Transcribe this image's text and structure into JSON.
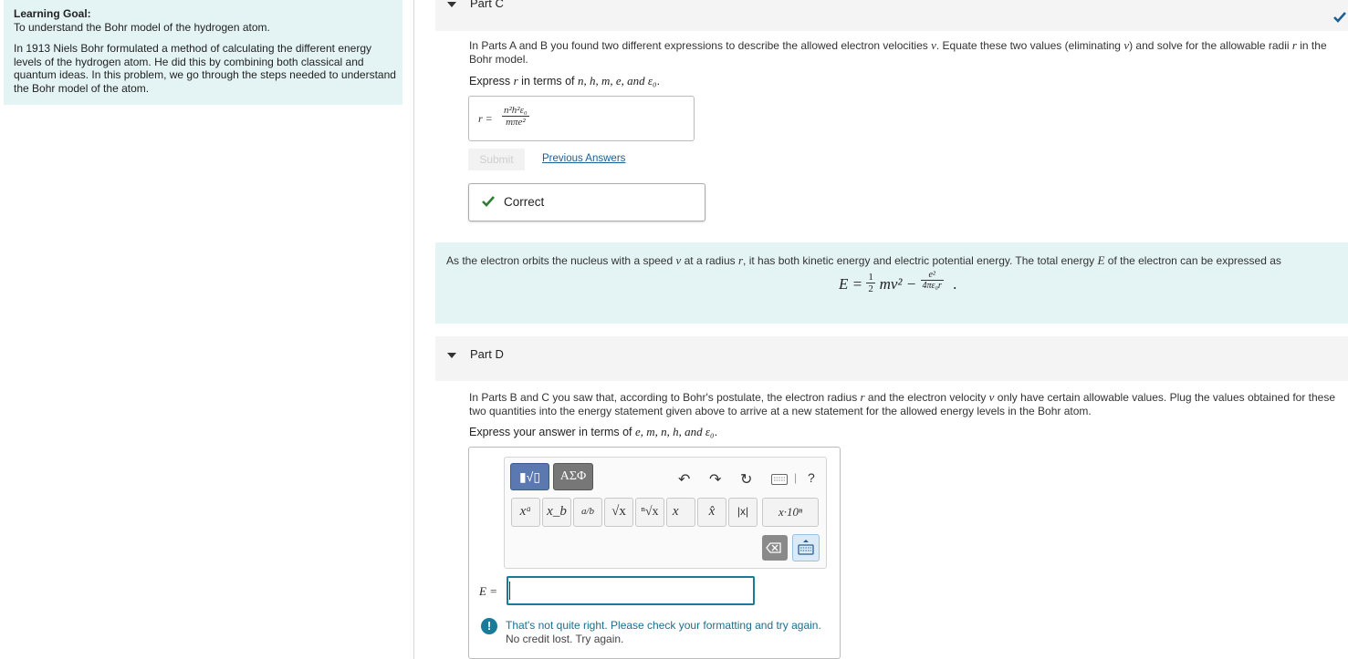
{
  "sidebar": {
    "goal_heading": "Learning Goal:",
    "goal_text": "To understand the Bohr model of the hydrogen atom.",
    "intro": "In 1913 Niels Bohr formulated a method of calculating the different energy levels of the hydrogen atom. He did this by combining both classical and quantum ideas. In this problem, we go through the steps needed to understand the Bohr model of the atom."
  },
  "part_c": {
    "title": "Part C",
    "q_a": "In Parts A and B you found two different expressions to describe the allowed electron velocities ",
    "q_b": ". Equate these two values (eliminating ",
    "q_c": ") and solve for the allowable radii ",
    "q_d": " in the Bohr model.",
    "express_a": "Express ",
    "express_b": " in terms of ",
    "express_vars": "n, h, m, e, and ",
    "answer_lhs": "r =",
    "answer_num": "n²h²ε₀",
    "answer_den": "mπe²",
    "submit": "Submit",
    "previous_answers": "Previous Answers",
    "feedback": "Correct"
  },
  "info": {
    "text_a": "As the electron orbits the nucleus with a speed ",
    "text_b": " at a radius ",
    "text_c": ", it has both kinetic energy and electric potential energy. The total energy ",
    "text_d": " of the electron can be expressed as",
    "eq_lhs": "E = ",
    "eq_half_num": "1",
    "eq_half_den": "2",
    "eq_mid": "mv² − ",
    "eq_frac_num": "e²",
    "eq_frac_den": "4πε₀r",
    "eq_end": "."
  },
  "part_d": {
    "title": "Part D",
    "q_a": "In Parts B and C you saw that, according to Bohr's postulate, the electron radius ",
    "q_b": " and the electron velocity ",
    "q_c": " only have certain allowable values. Plug the values obtained for these two quantities into the energy statement given above to arrive at a new statement for the allowed energy levels in the Bohr atom.",
    "express": "Express your answer in terms of ",
    "express_vars": "e, m, n, h, and ε₀",
    "answer_lhs": "E =",
    "answer_value": "",
    "feedback_1": "That's not quite right. Please check your formatting and try again.",
    "feedback_2": "No credit lost. Try again."
  },
  "toolbar": {
    "mode_templates": "▮√▯",
    "mode_greek": "ΑΣΦ",
    "undo": "↶",
    "redo": "↷",
    "reset": "↻",
    "help": "?",
    "symbols": [
      "xᵃ",
      "x_b",
      "a/b",
      "√x",
      "ⁿ√x",
      "x⃗",
      "x̂",
      "|x|",
      "x·10ⁿ"
    ]
  },
  "colors": {
    "accent": "#1a7a99",
    "correct": "#2e7d32",
    "band": "#e4f4f4"
  },
  "v": "v",
  "r": "r",
  "E": "E",
  "eps": "ε₀"
}
